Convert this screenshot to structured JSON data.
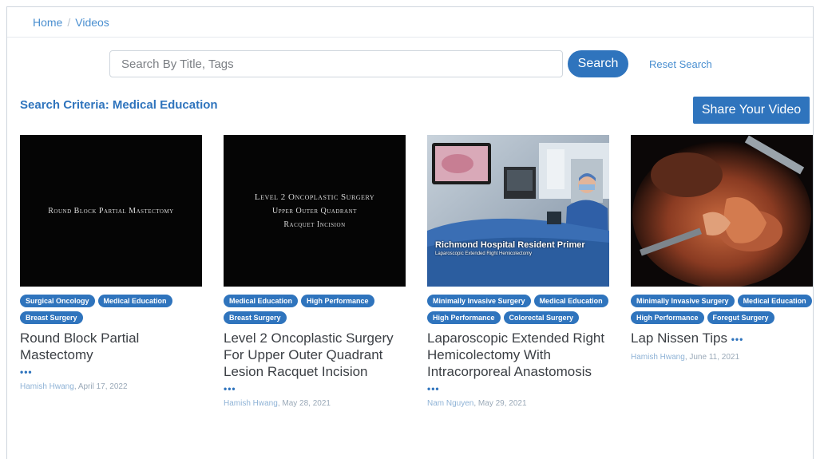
{
  "breadcrumb": {
    "home": "Home",
    "separator": "/",
    "current": "Videos"
  },
  "search": {
    "placeholder": "Search By Title, Tags",
    "value": "",
    "button": "Search",
    "reset": "Reset Search"
  },
  "criteria": "Search Criteria: Medical Education",
  "share_button": "Share Your Video",
  "colors": {
    "accent": "#2f74bd",
    "link": "#4a8fd0"
  },
  "videos": [
    {
      "thumb_text": [
        "Round Block Partial Mastectomy"
      ],
      "tags": [
        "Surgical Oncology",
        "Medical Education",
        "Breast Surgery"
      ],
      "title": "Round Block Partial Mastectomy",
      "more": "•••",
      "author": "Hamish Hwang",
      "date": "April 17, 2022"
    },
    {
      "thumb_text": [
        "Level 2 Oncoplastic Surgery",
        "Upper Outer Quadrant",
        "Racquet Incision"
      ],
      "tags": [
        "Medical Education",
        "High Performance",
        "Breast Surgery"
      ],
      "title": "Level 2 Oncoplastic Surgery For Upper Outer Quadrant Lesion Racquet Incision",
      "more": "•••",
      "author": "Hamish Hwang",
      "date": "May 28, 2021"
    },
    {
      "thumb_text": [
        "Richmond Hospital Resident Primer",
        "Laparoscopic Extended Right Hemicolectomy"
      ],
      "tags": [
        "Minimally Invasive Surgery",
        "Medical Education",
        "High Performance",
        "Colorectal Surgery"
      ],
      "title": "Laparoscopic Extended Right Hemicolectomy With Intracorporeal Anastomosis",
      "more": "•••",
      "author": "Nam Nguyen",
      "date": "May 29, 2021"
    },
    {
      "thumb_text": [],
      "tags": [
        "Minimally Invasive Surgery",
        "Medical Education",
        "High Performance",
        "Foregut Surgery"
      ],
      "title": "Lap Nissen Tips",
      "more": "•••",
      "author": "Hamish Hwang",
      "date": "June 11, 2021"
    }
  ]
}
